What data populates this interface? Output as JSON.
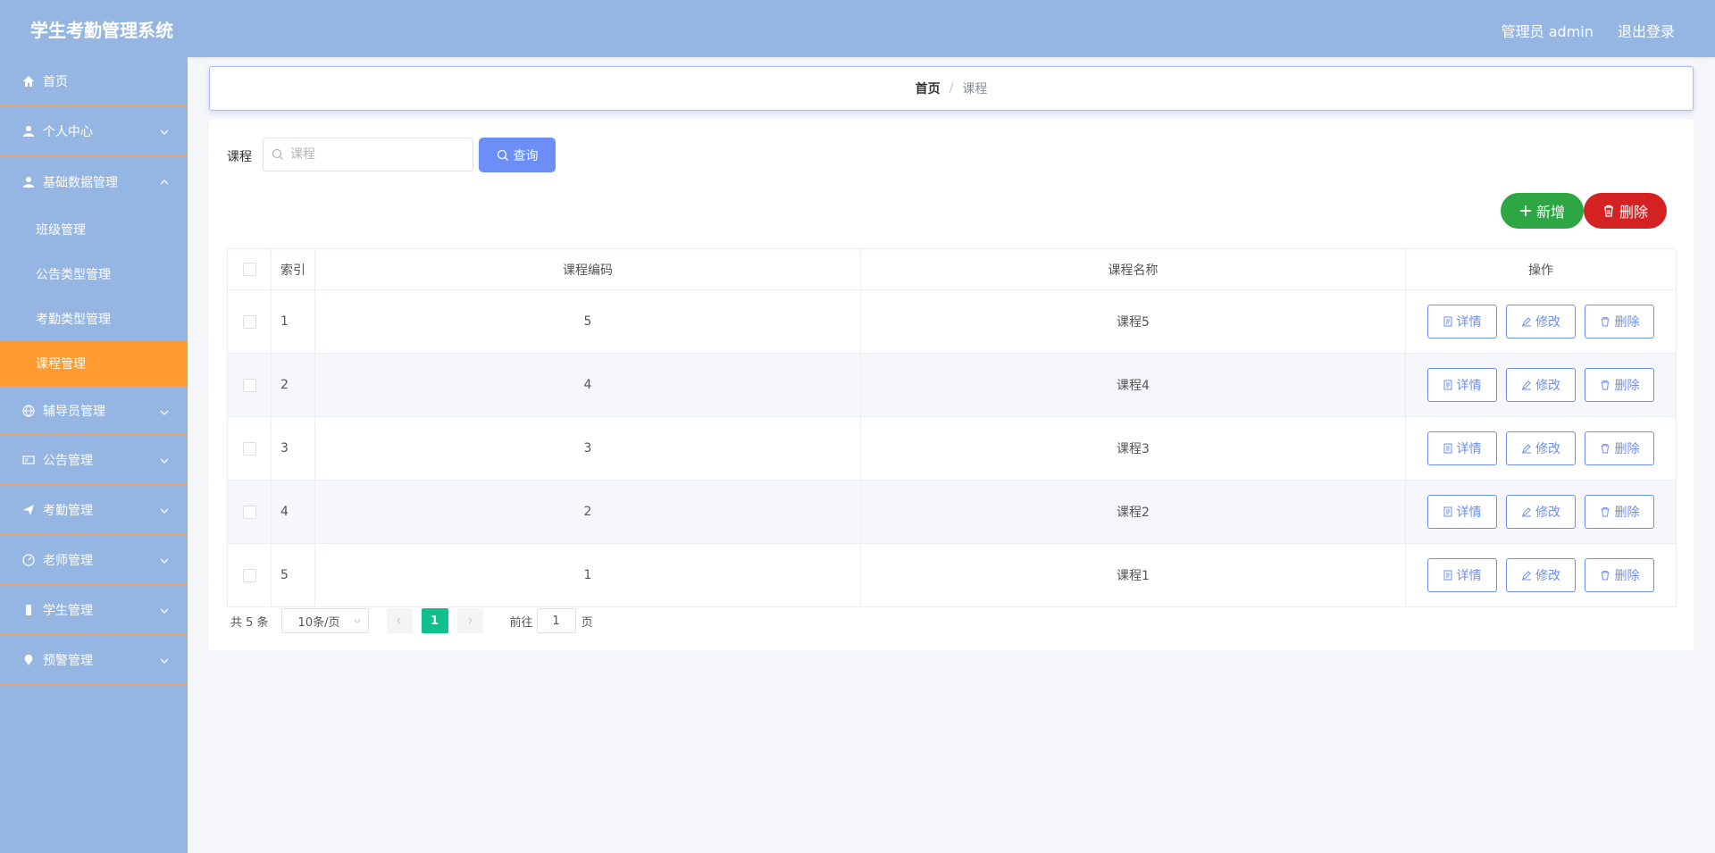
{
  "app": {
    "title": "学生考勤管理系统"
  },
  "header": {
    "user": "管理员 admin",
    "logout": "退出登录"
  },
  "sidebar": {
    "items": [
      {
        "label": "首页",
        "icon": "home-icon"
      },
      {
        "label": "个人中心",
        "icon": "user-icon"
      },
      {
        "label": "基础数据管理",
        "icon": "user-icon",
        "expanded": true,
        "children": [
          {
            "label": "班级管理"
          },
          {
            "label": "公告类型管理"
          },
          {
            "label": "考勤类型管理"
          },
          {
            "label": "课程管理",
            "active": true
          }
        ]
      },
      {
        "label": "辅导员管理",
        "icon": "globe-icon"
      },
      {
        "label": "公告管理",
        "icon": "card-icon"
      },
      {
        "label": "考勤管理",
        "icon": "send-icon"
      },
      {
        "label": "老师管理",
        "icon": "gauge-icon"
      },
      {
        "label": "学生管理",
        "icon": "phone-icon"
      },
      {
        "label": "预警管理",
        "icon": "location-icon"
      }
    ]
  },
  "breadcrumb": {
    "home": "首页",
    "separator": "/",
    "current": "课程"
  },
  "search": {
    "label": "课程",
    "placeholder": "课程",
    "button": "查询"
  },
  "actions": {
    "add": "新增",
    "delete": "删除"
  },
  "table": {
    "columns": [
      "索引",
      "课程编码",
      "课程名称",
      "操作"
    ],
    "rows": [
      {
        "index": "1",
        "code": "5",
        "name": "课程5"
      },
      {
        "index": "2",
        "code": "4",
        "name": "课程4"
      },
      {
        "index": "3",
        "code": "3",
        "name": "课程3"
      },
      {
        "index": "4",
        "code": "2",
        "name": "课程2"
      },
      {
        "index": "5",
        "code": "1",
        "name": "课程1"
      }
    ],
    "row_actions": {
      "detail": "详情",
      "edit": "修改",
      "delete": "删除"
    }
  },
  "pagination": {
    "total": "共 5 条",
    "page_size": "10条/页",
    "current_page": "1",
    "goto_label": "前往",
    "goto_value": "1",
    "page_suffix": "页"
  },
  "colors": {
    "header": "#95b6e3",
    "active_menu": "#ff9a30",
    "primary": "#6b8ef7",
    "success": "#2ea644",
    "danger": "#d42222",
    "page_active": "#10c08a"
  }
}
